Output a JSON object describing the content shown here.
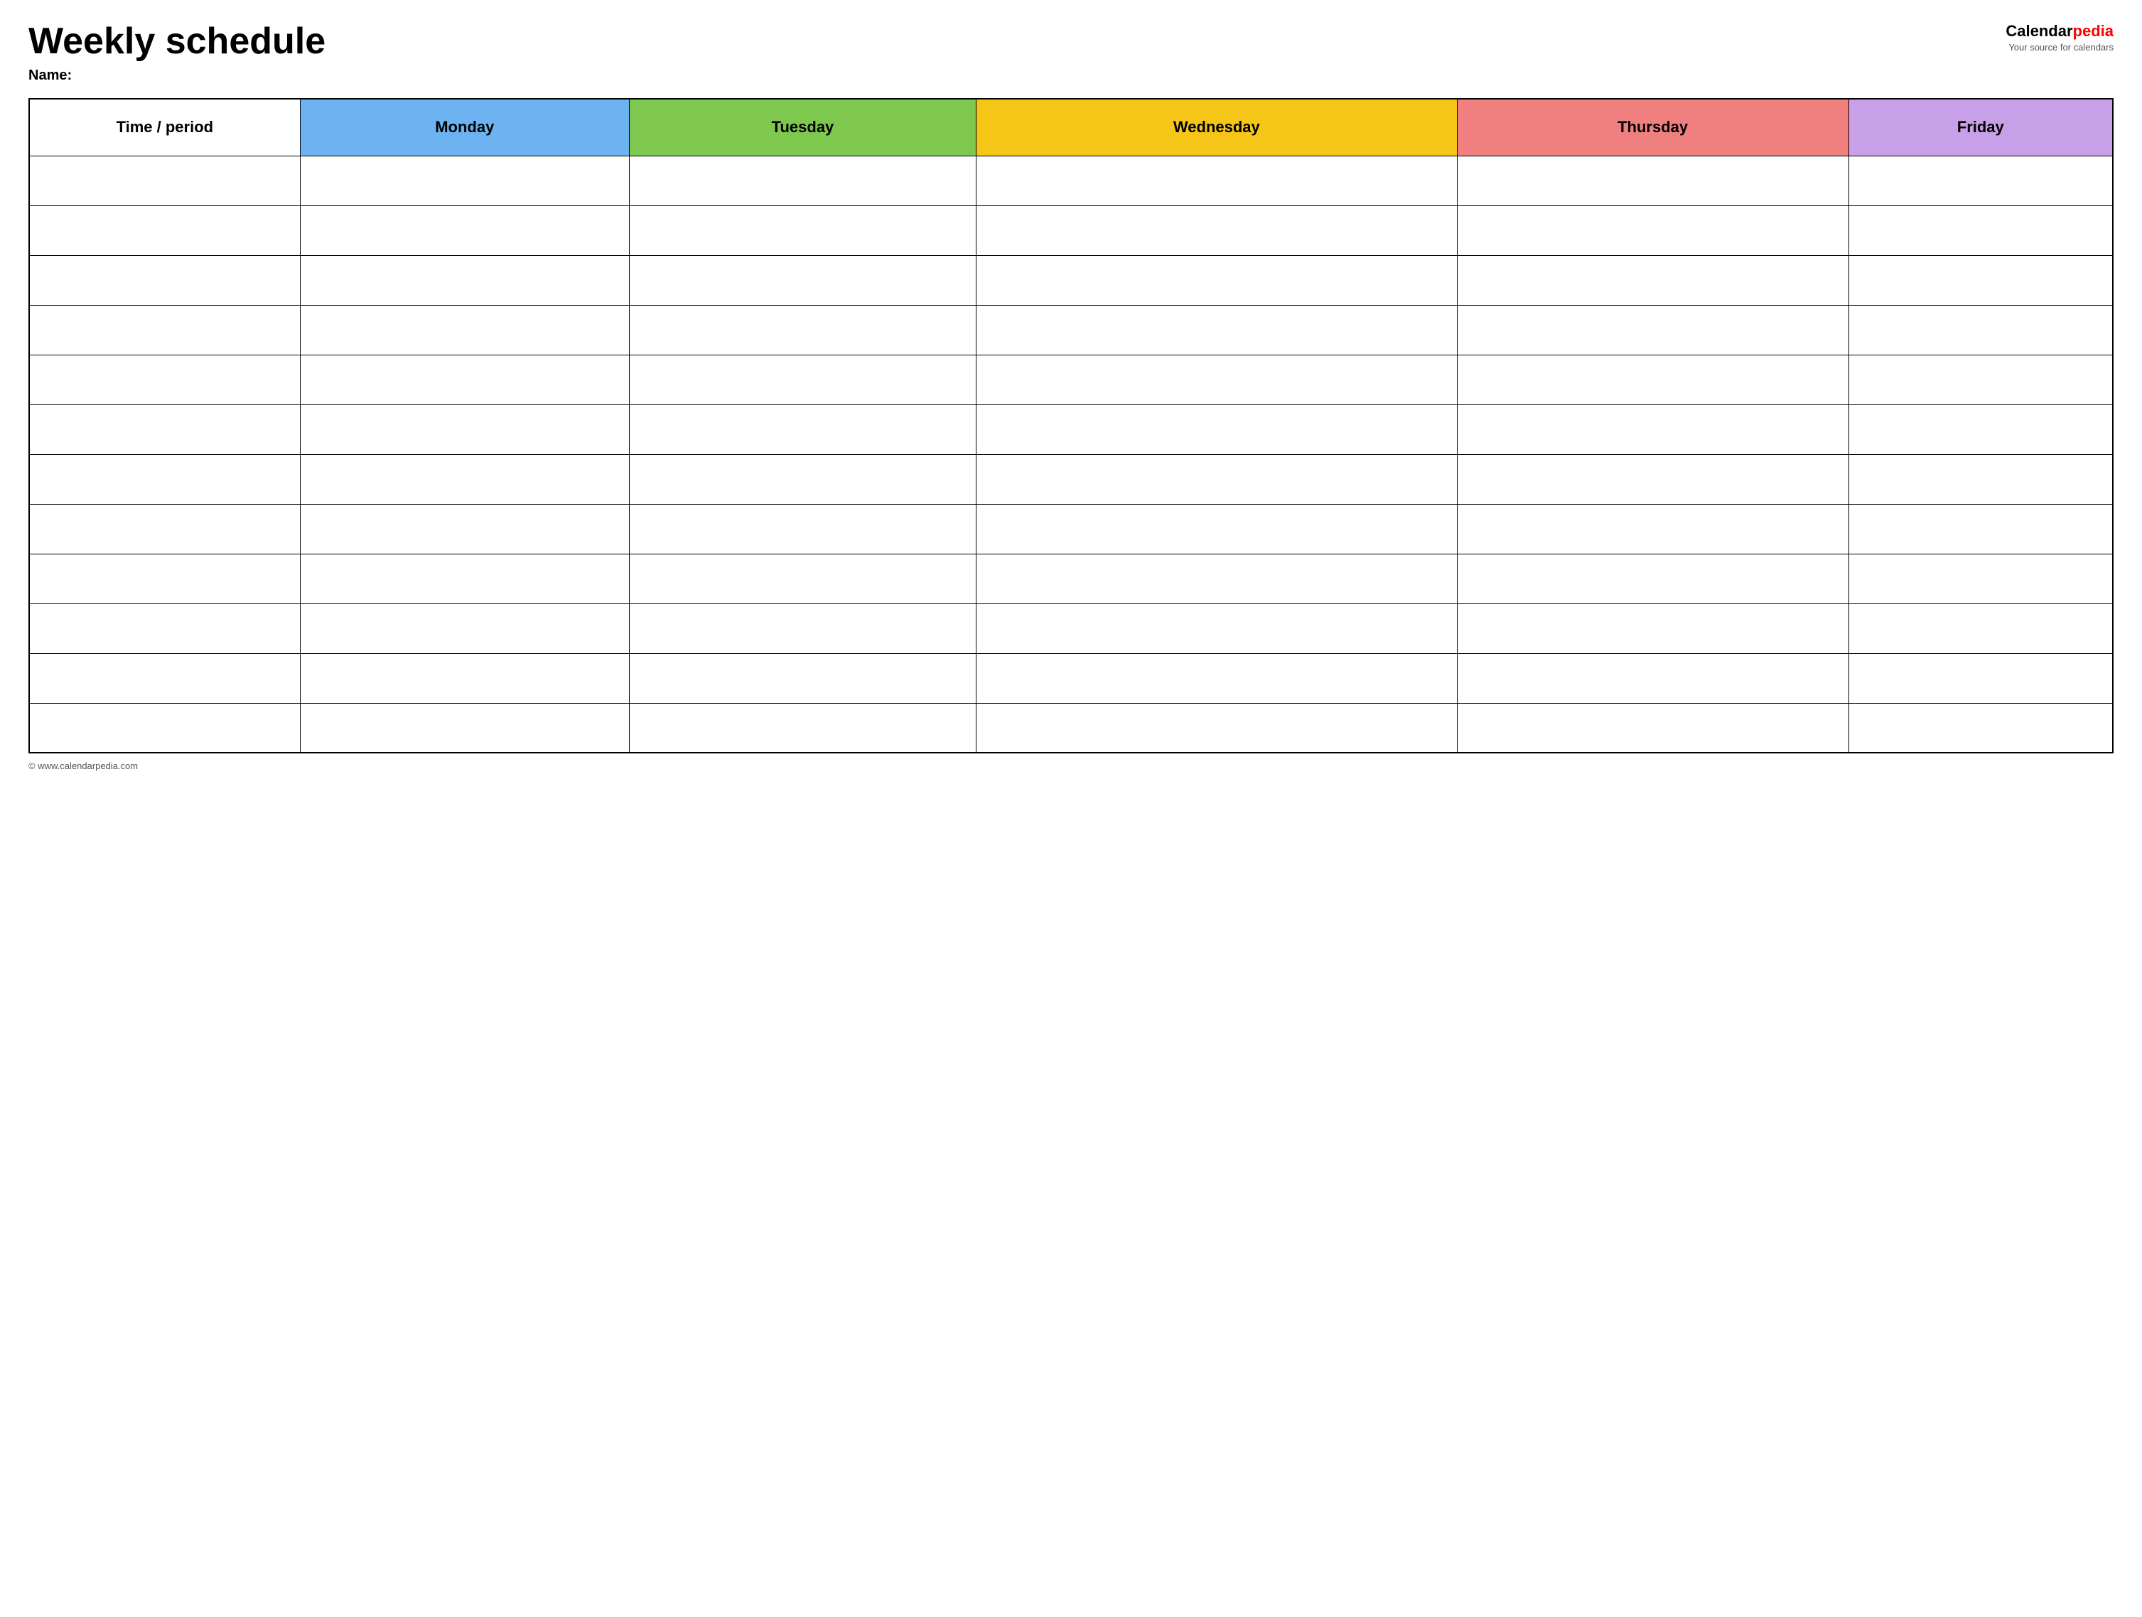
{
  "header": {
    "title": "Weekly schedule",
    "name_label": "Name:",
    "logo": {
      "calendar": "Calendar",
      "pedia": "pedia",
      "subtitle": "Your source for calendars"
    }
  },
  "table": {
    "columns": [
      {
        "id": "time",
        "label": "Time / period",
        "color": "#ffffff"
      },
      {
        "id": "monday",
        "label": "Monday",
        "color": "#6db3f2"
      },
      {
        "id": "tuesday",
        "label": "Tuesday",
        "color": "#7ec850"
      },
      {
        "id": "wednesday",
        "label": "Wednesday",
        "color": "#f5c518"
      },
      {
        "id": "thursday",
        "label": "Thursday",
        "color": "#f08080"
      },
      {
        "id": "friday",
        "label": "Friday",
        "color": "#c8a0e8"
      }
    ],
    "rows": 12
  },
  "footer": {
    "url": "© www.calendarpedia.com"
  }
}
